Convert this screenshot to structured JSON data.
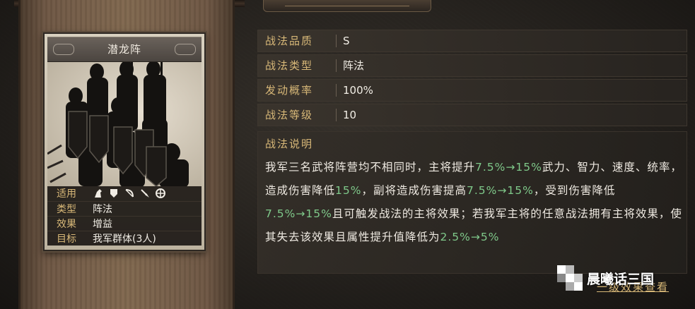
{
  "card": {
    "title": "潜龙阵",
    "info": [
      {
        "key": "适用",
        "value": "",
        "icons": [
          "horse-cavalry-icon",
          "shield-infantry-icon",
          "bow-archer-icon",
          "spear-icon",
          "wheel-siege-icon"
        ]
      },
      {
        "key": "类型",
        "value": "阵法"
      },
      {
        "key": "效果",
        "value": "增益"
      },
      {
        "key": "目标",
        "value": "我军群体(3人)"
      }
    ]
  },
  "stats": [
    {
      "label": "战法品质",
      "value": "S"
    },
    {
      "label": "战法类型",
      "value": "阵法"
    },
    {
      "label": "发动概率",
      "value": "100%"
    },
    {
      "label": "战法等级",
      "value": "10"
    }
  ],
  "description": {
    "title": "战法说明",
    "segments": [
      {
        "text": "我军三名武将阵营均不相同时，主将提升",
        "hl": false
      },
      {
        "text": "7.5%→15%",
        "hl": true
      },
      {
        "text": "武力、智力、速度、统率，造成伤害降低",
        "hl": false
      },
      {
        "text": "15%",
        "hl": true
      },
      {
        "text": "，副将造成伤害提高",
        "hl": false
      },
      {
        "text": "7.5%→15%",
        "hl": true
      },
      {
        "text": "，受到伤害降低",
        "hl": false
      },
      {
        "text": "7.5%→15%",
        "hl": true
      },
      {
        "text": "且可触发战法的主将效果；若我军主将的任意战法拥有主将效果，使其失去该效果且属性提升值降低为",
        "hl": false
      },
      {
        "text": "2.5%→5%",
        "hl": true
      }
    ]
  },
  "footer": {
    "link": "一级效果查看",
    "watermark": "晨曦话三国"
  },
  "colors": {
    "label_gold": "#d8b878",
    "highlight_green": "#7fc98a"
  }
}
